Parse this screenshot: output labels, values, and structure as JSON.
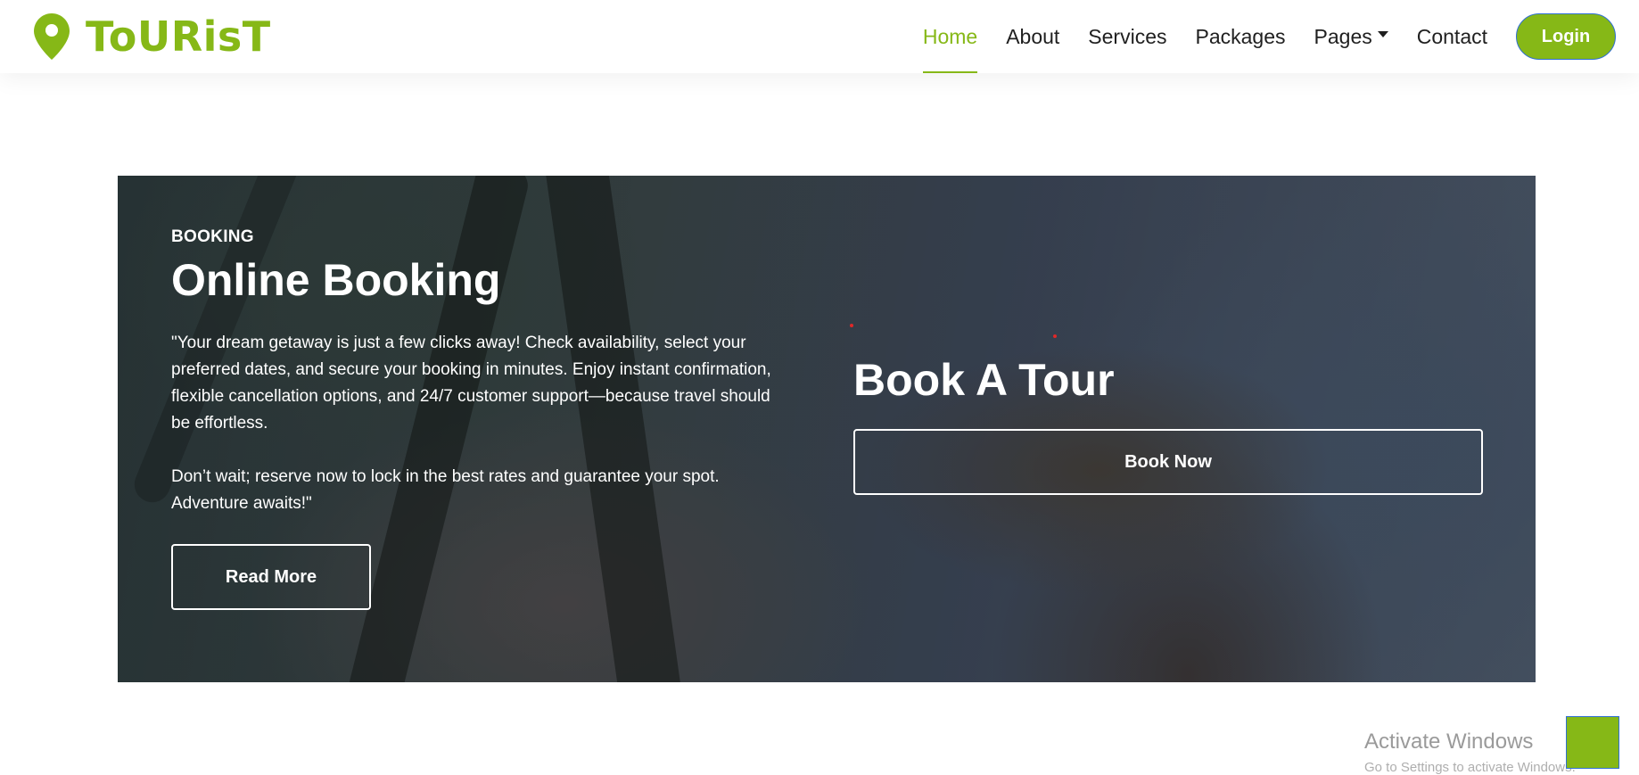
{
  "brand": {
    "name": "ToURisT",
    "icon": "map-pin-icon",
    "color": "#86b817"
  },
  "nav": {
    "items": [
      {
        "label": "Home",
        "active": true
      },
      {
        "label": "About"
      },
      {
        "label": "Services"
      },
      {
        "label": "Packages"
      },
      {
        "label": "Pages"
      },
      {
        "label": "Contact"
      }
    ],
    "login_label": "Login"
  },
  "booking": {
    "label": "BOOKING",
    "title": "Online Booking",
    "paragraph1": "\"Your dream getaway is just a few clicks away! Check availability, select your preferred dates, and secure your booking in minutes. Enjoy instant confirmation, flexible cancellation options, and 24/7 customer support—because travel should be effortless.",
    "paragraph2": "Don’t wait; reserve now to lock in the best rates and guarantee your spot. Adventure awaits!\"",
    "read_more_label": "Read More",
    "book_title": "Book A Tour",
    "book_now_label": "Book Now"
  },
  "windows": {
    "activate": "Activate Windows",
    "sub": "Go to Settings to activate Windows."
  }
}
